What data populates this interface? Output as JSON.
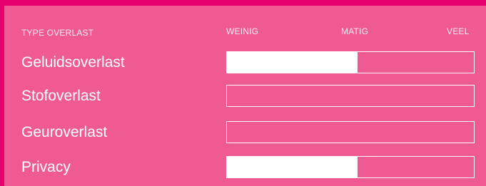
{
  "table": {
    "header": {
      "type": "TYPE OVERLAST",
      "scale": [
        "WEINIG",
        "MATIG",
        "VEEL"
      ]
    },
    "rows": [
      {
        "label": "Geluidsoverlast",
        "level": 0.53
      },
      {
        "label": "Stofoverlast",
        "level": 0
      },
      {
        "label": "Geuroverlast",
        "level": 0
      },
      {
        "label": "Privacy",
        "level": 0.53
      }
    ]
  },
  "colors": {
    "frame": "#e5006d",
    "panel": "#ef5a93",
    "bar_border": "#ffffff",
    "bar_fill": "#ffffff"
  }
}
